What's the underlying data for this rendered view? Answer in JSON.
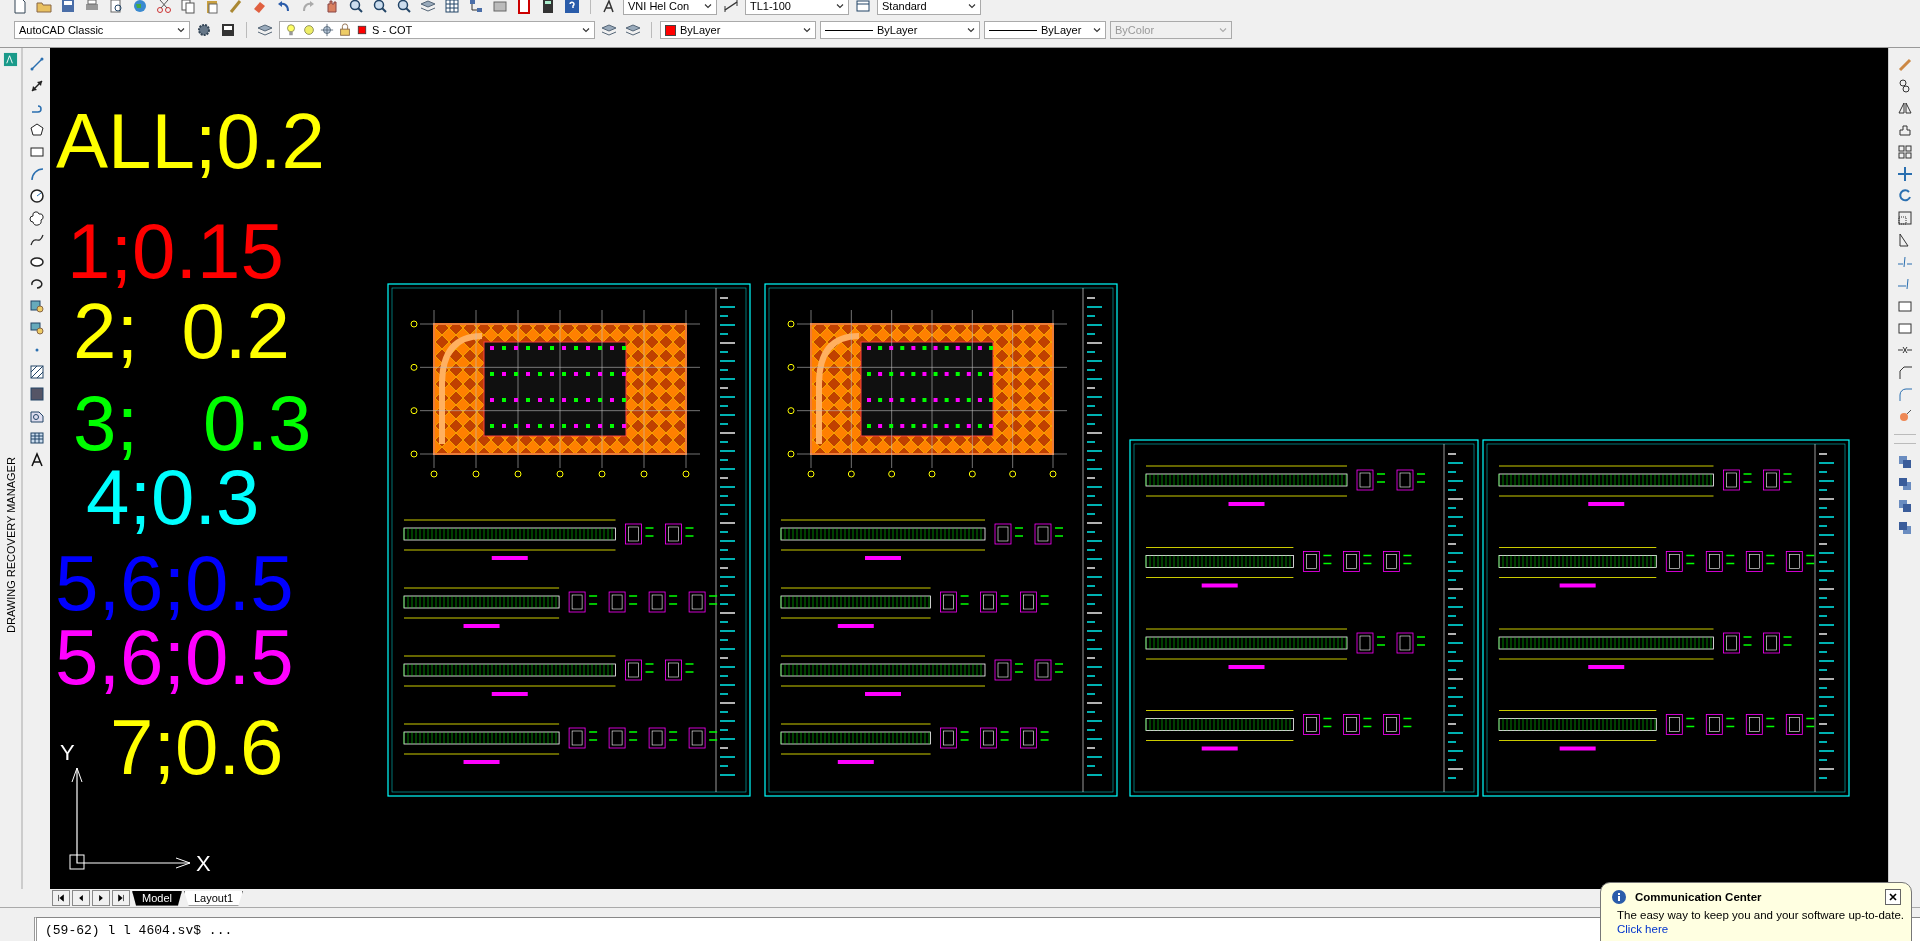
{
  "toolbar_top": {
    "text_style": "VNI Hel Con",
    "dim_style": "TL1-100",
    "table_style": "Standard"
  },
  "toolbar_second": {
    "workspace": "AutoCAD Classic",
    "layer": "S - COT",
    "color_control": "ByLayer",
    "linetype": "ByLayer",
    "lineweight": "ByLayer",
    "plot_style": {
      "value": "ByColor",
      "disabled": true
    }
  },
  "side_panel": {
    "title": "DRAWING RECOVERY MANAGER"
  },
  "canvas": {
    "legend": [
      {
        "text": "ALL;0.2",
        "color": "#ffff00"
      },
      {
        "text": "1;0.15",
        "color": "#ff0000"
      },
      {
        "text": "2;  0.2",
        "color": "#ffff00"
      },
      {
        "text": "3;   0.3",
        "color": "#00ff00"
      },
      {
        "text": "4;0.3",
        "color": "#00ffff"
      },
      {
        "text": "5,6;0.5",
        "color": "#0000ff"
      },
      {
        "text": "5,6;0.5",
        "color": "#ff00ff"
      },
      {
        "text": "7;0.6",
        "color": "#ffff00"
      }
    ],
    "ucs": {
      "y_label": "Y",
      "x_label": "X"
    }
  },
  "layout_tabs": [
    {
      "label": "Model",
      "selected": true
    },
    {
      "label": "Layout1",
      "selected": false
    }
  ],
  "command_line": "(59-62) l l 4604.sv$ ...",
  "notification": {
    "title": "Communication Center",
    "message": "The easy way to keep you and your software up-to-date.",
    "link": "Click here"
  }
}
